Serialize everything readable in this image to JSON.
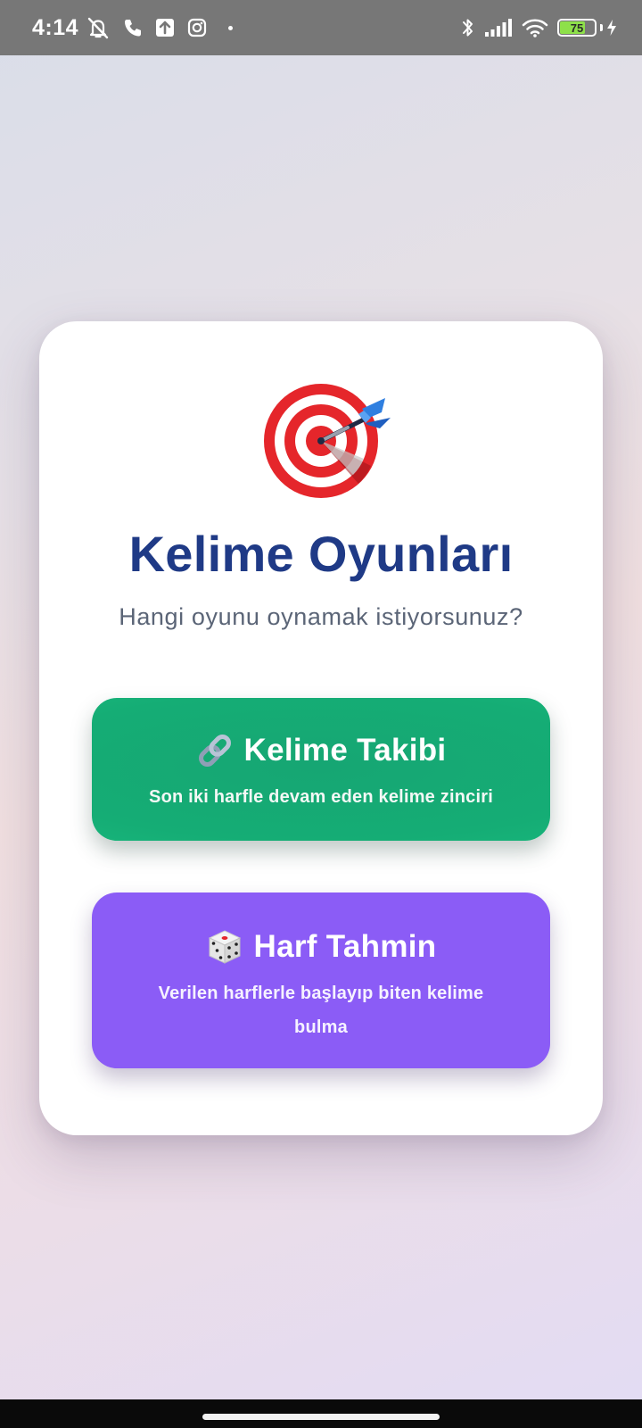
{
  "status_bar": {
    "time": "4:14",
    "battery_level": "75",
    "battery_fraction": 0.75,
    "left_icons": [
      "alarm-off-icon",
      "phone-call-icon",
      "upload-icon",
      "instagram-icon",
      "notification-dot-icon"
    ],
    "right_icons": [
      "bluetooth-icon",
      "signal-icon",
      "wifi-icon",
      "battery-icon",
      "charging-bolt-icon"
    ]
  },
  "card": {
    "icon": "target-dart-icon",
    "title": "Kelime Oyunları",
    "subtitle": "Hangi oyunu oynamak istiyorsunuz?"
  },
  "games": [
    {
      "icon": "link-icon",
      "title": "Kelime Takibi",
      "description": "Son iki harfle devam eden kelime zinciri",
      "color": "#16a673"
    },
    {
      "icon": "dice-icon",
      "title": "Harf Tahmin",
      "description": "Verilen harflerle başlayıp biten kelime bulma",
      "color": "#8b5cf6"
    }
  ],
  "colors": {
    "title": "#1f3a86",
    "subtitle": "#5b6577",
    "status_bar": "#777777"
  }
}
